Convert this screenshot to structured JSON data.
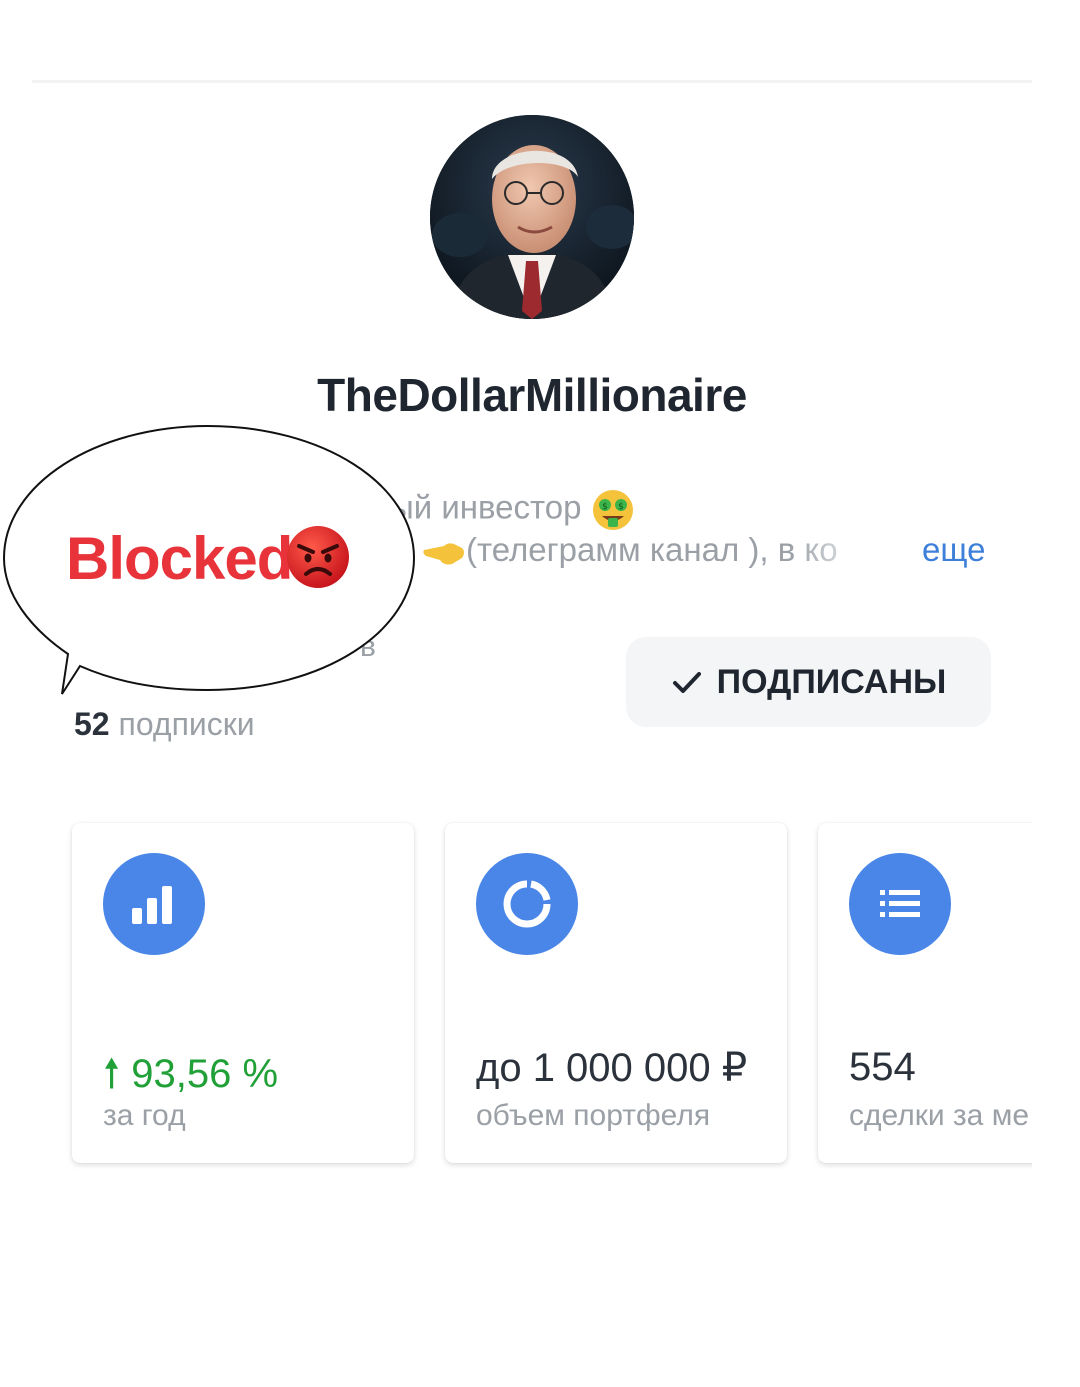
{
  "profile": {
    "name": "TheDollarMillionaire",
    "bio_line_1": "ый инвестор",
    "bio_line_2": "(телеграмм канал ), в ко",
    "more_label": "еще",
    "followers_hint": "в",
    "subscriptions_count": "52",
    "subscriptions_label": "подписки"
  },
  "subscribe_button": {
    "label": "ПОДПИСАНЫ",
    "icon": "checkmark-icon"
  },
  "stats": [
    {
      "icon": "bar-chart-icon",
      "value": "93,56 %",
      "label": "за год",
      "trend_icon": "arrow-up-icon",
      "color": "#21a038"
    },
    {
      "icon": "pie-chart-icon",
      "value": "до 1 000 000 ₽",
      "label": "объем портфеля"
    },
    {
      "icon": "list-icon",
      "value": "554",
      "label": "сделки за ме"
    }
  ],
  "callout": {
    "text": "Blocked",
    "emoji": "angry-face-icon",
    "text_color": "#e8333a"
  },
  "colors": {
    "accent_blue": "#4a86e8",
    "link_blue": "#3d7fd9",
    "positive_green": "#21a038"
  }
}
